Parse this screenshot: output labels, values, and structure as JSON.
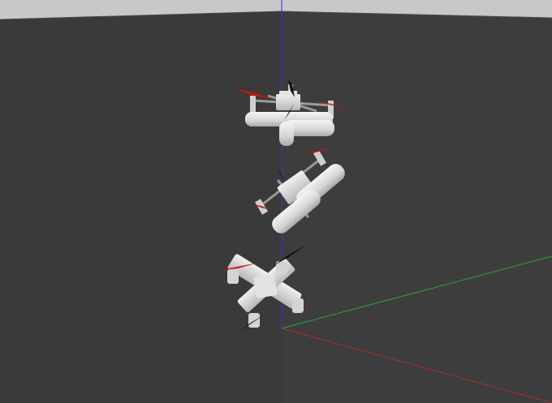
{
  "scene": {
    "background_color": "#3b3b3b",
    "sky_color": "#c8c8c8",
    "axes": {
      "x_color": "#b02a2a",
      "y_color": "#22a83a",
      "z_color": "#3838c8"
    },
    "models": [
      {
        "name": "quadcopter-upright",
        "body_color": "#d8d8d8",
        "prop_colors": [
          "#c41414",
          "#101010"
        ]
      },
      {
        "name": "quadcopter-tilted",
        "body_color": "#d8d8d8",
        "prop_colors": [
          "#c41414",
          "#101010"
        ]
      },
      {
        "name": "quadcopter-inverted",
        "body_color": "#d8d8d8",
        "prop_colors": [
          "#c41414",
          "#101010"
        ]
      }
    ]
  }
}
